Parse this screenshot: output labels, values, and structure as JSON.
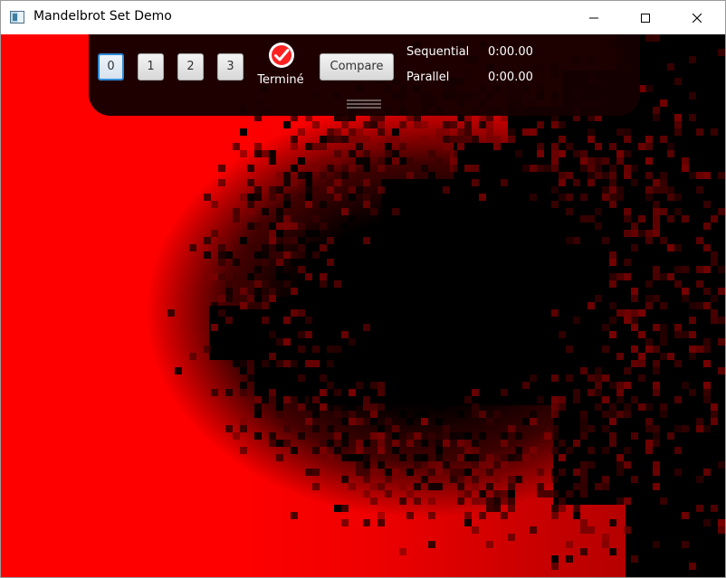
{
  "window": {
    "title": "Mandelbrot Set Demo",
    "icon": "app-window-icon",
    "controls": {
      "minimize_icon": "minimize-icon",
      "maximize_icon": "maximize-icon",
      "close_icon": "close-icon"
    }
  },
  "toolbar": {
    "levels": [
      "0",
      "1",
      "2",
      "3"
    ],
    "selected_level": "0",
    "status": {
      "icon": "check-circle-icon",
      "label": "Terminé",
      "color": "#ff2222"
    },
    "compare_label": "Compare",
    "timings": {
      "sequential_label": "Sequential",
      "sequential_value": "0:00.00",
      "parallel_label": "Parallel",
      "parallel_value": "0:00.00"
    },
    "grip_icon": "drag-grip-icon"
  },
  "fractal": {
    "palette": {
      "outside_bright": "#ff0000",
      "inside": "#000000"
    }
  }
}
